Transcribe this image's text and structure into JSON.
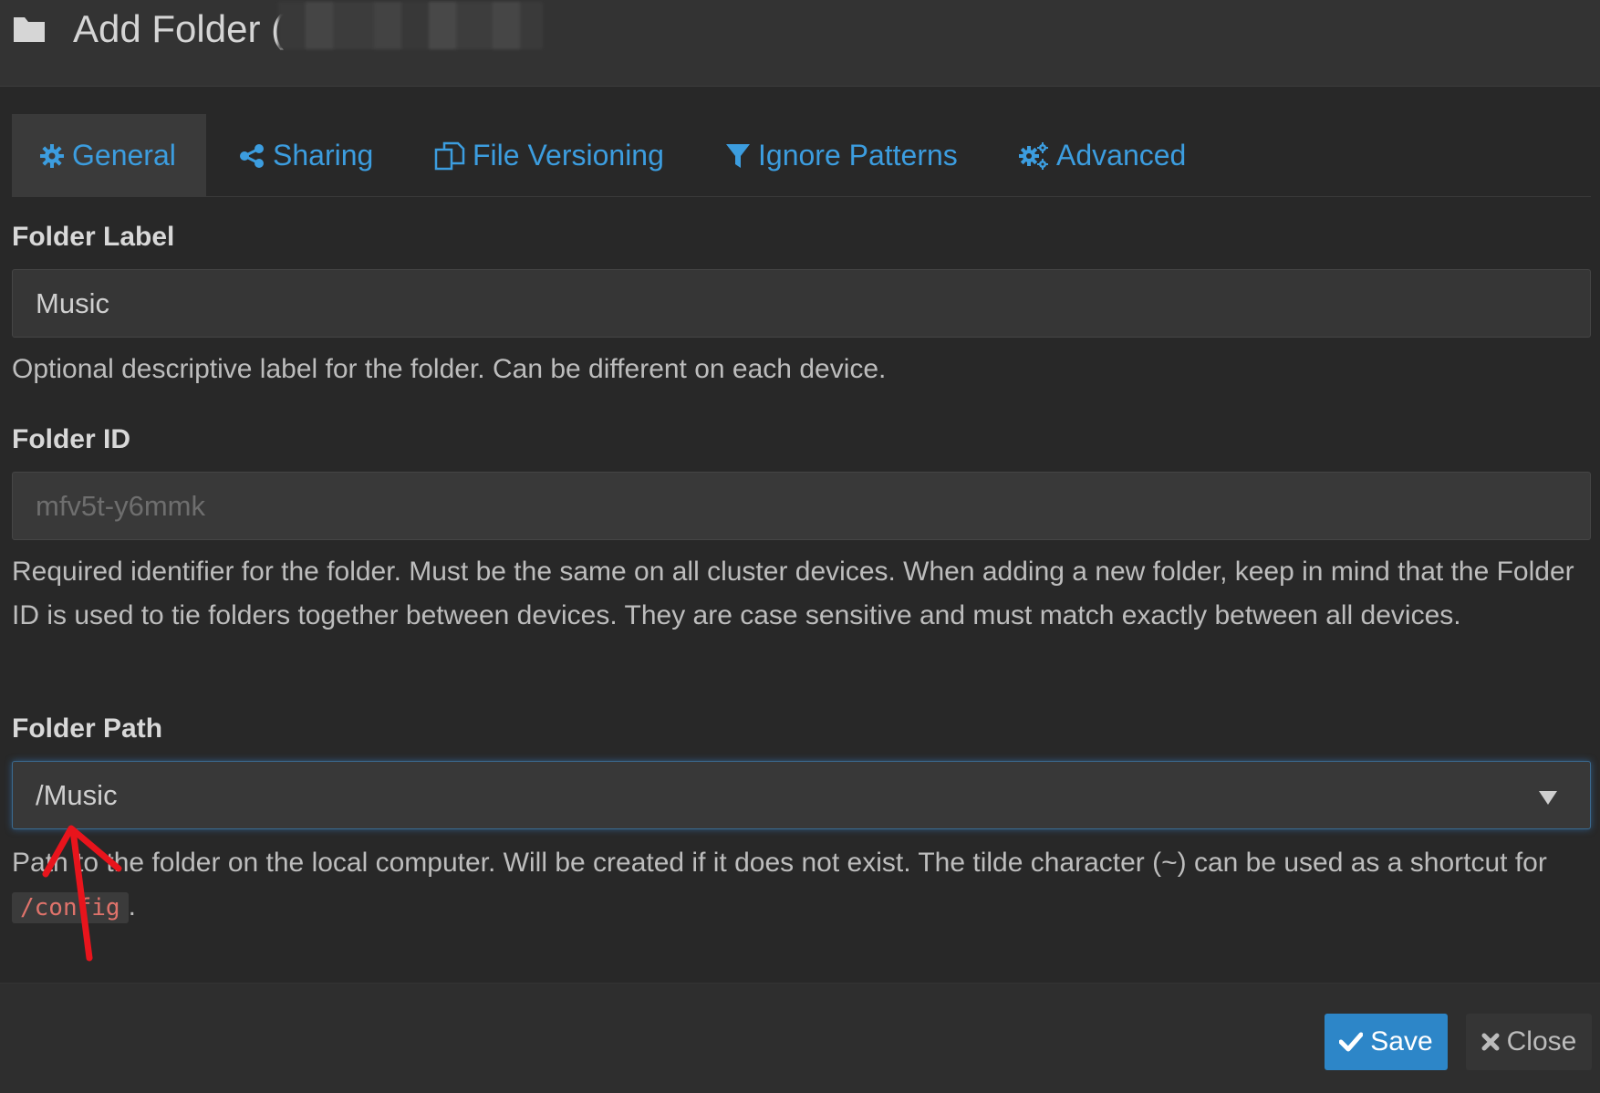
{
  "header": {
    "title": "Add Folder (",
    "icon": "folder-icon"
  },
  "tabs": [
    {
      "label": "General",
      "icon": "gear-icon",
      "active": true
    },
    {
      "label": "Sharing",
      "icon": "share-icon",
      "active": false
    },
    {
      "label": "File Versioning",
      "icon": "copy-icon",
      "active": false
    },
    {
      "label": "Ignore Patterns",
      "icon": "filter-icon",
      "active": false
    },
    {
      "label": "Advanced",
      "icon": "gears-icon",
      "active": false
    }
  ],
  "form": {
    "folder_label": {
      "label": "Folder Label",
      "value": "Music",
      "help": "Optional descriptive label for the folder. Can be different on each device."
    },
    "folder_id": {
      "label": "Folder ID",
      "placeholder": "mfv5t-y6mmk",
      "help": "Required identifier for the folder. Must be the same on all cluster devices. When adding a new folder, keep in mind that the Folder ID is used to tie folders together between devices. They are case sensitive and must match exactly between all devices."
    },
    "folder_path": {
      "label": "Folder Path",
      "value": "/Music",
      "help_before": "Path to the folder on the local computer. Will be created if it does not exist. The tilde character (~) can be used as a shortcut for ",
      "help_code": "/config",
      "help_after": "."
    }
  },
  "footer": {
    "save_label": "Save",
    "close_label": "Close"
  },
  "colors": {
    "accent": "#3c9ddf",
    "primary_button": "#2d86c8",
    "background": "#282828",
    "annotation": "#e8141c"
  }
}
